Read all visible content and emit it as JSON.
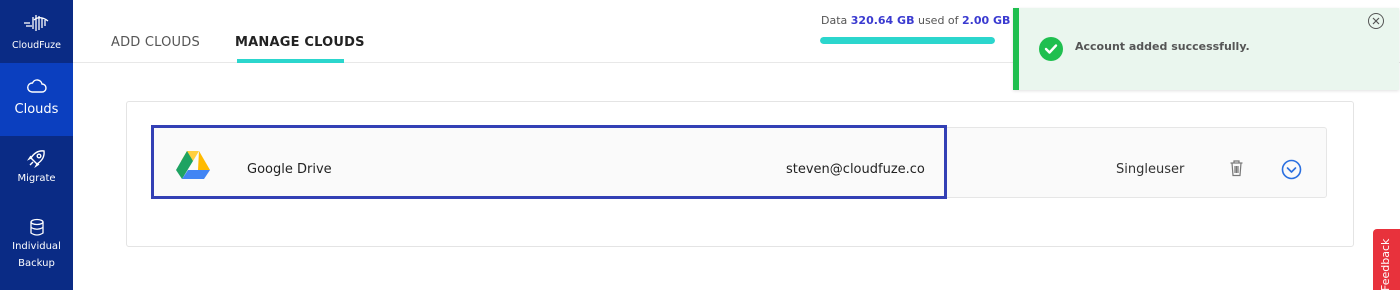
{
  "brand": {
    "name": "CloudFuze"
  },
  "sidebar": {
    "items": [
      {
        "label": "Clouds",
        "icon": "cloud-icon",
        "active": true
      },
      {
        "label": "Migrate",
        "icon": "rocket-icon",
        "active": false
      },
      {
        "label": "Individual",
        "label2": "Backup",
        "icon": "database-icon",
        "active": false
      }
    ]
  },
  "header": {
    "tabs": [
      {
        "label": "ADD CLOUDS",
        "active": false
      },
      {
        "label": "MANAGE CLOUDS",
        "active": true
      }
    ]
  },
  "usage": {
    "prefix": "Data",
    "used": "320.64 GB",
    "middle": "used of",
    "total": "2.00 GB",
    "fill_fraction": 1.0
  },
  "toast": {
    "message": "Account added successfully.",
    "icon": "check-circle-icon",
    "close_icon": "close-circle-icon",
    "accent": "#1fbf4f"
  },
  "clouds": [
    {
      "name": "Google Drive",
      "email": "steven@cloudfuze.co",
      "type": "Singleuser",
      "icon": "google-drive-icon"
    }
  ],
  "feedback": {
    "label": "Feedback"
  },
  "colors": {
    "sidebar": "#0a2b85",
    "sidebar_active": "#0b3fbf",
    "accent": "#2bd6cd",
    "highlight": "#3340b5",
    "feedback": "#e8323c"
  }
}
